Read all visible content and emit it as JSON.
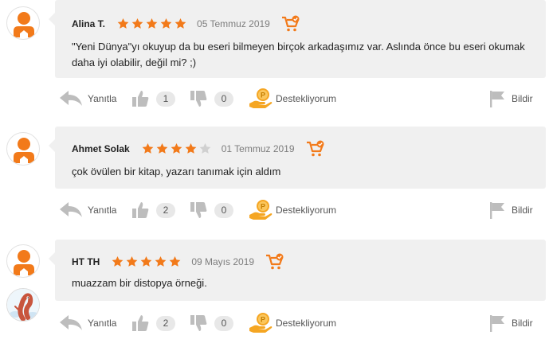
{
  "colors": {
    "accent": "#f27a1a",
    "star_off": "#d0d0d0",
    "icon_gray": "#bdbdbd",
    "coin": "#f5a623"
  },
  "icons": [
    "reply-arrow-icon",
    "thumbs-up-icon",
    "thumbs-down-icon",
    "coin-hand-icon",
    "flag-icon",
    "cart-check-icon",
    "star-icon"
  ],
  "reviews": [
    {
      "name": "Alina T.",
      "rating": 5,
      "date": "05 Temmuz 2019",
      "text": "\"Yeni Dünya\"yı okuyup da bu eseri bilmeyen birçok arkadaşımız var. Aslında önce bu eseri okumak daha iyi olabilir, değil mi? ;)",
      "reply_label": "Yanıtla",
      "likes": "1",
      "dislikes": "0",
      "support_label": "Destekliyorum",
      "report_label": "Bildir"
    },
    {
      "name": "Ahmet Solak",
      "rating": 4,
      "date": "01 Temmuz 2019",
      "text": "çok övülen bir kitap, yazarı tanımak için aldım",
      "reply_label": "Yanıtla",
      "likes": "2",
      "dislikes": "0",
      "support_label": "Destekliyorum",
      "report_label": "Bildir"
    },
    {
      "name": "HT TH",
      "rating": 5,
      "date": "09 Mayıs 2019",
      "text": "muazzam bir distopya örneği.",
      "reply_label": "Yanıtla",
      "likes": "2",
      "dislikes": "0",
      "support_label": "Destekliyorum",
      "report_label": "Bildir"
    }
  ]
}
